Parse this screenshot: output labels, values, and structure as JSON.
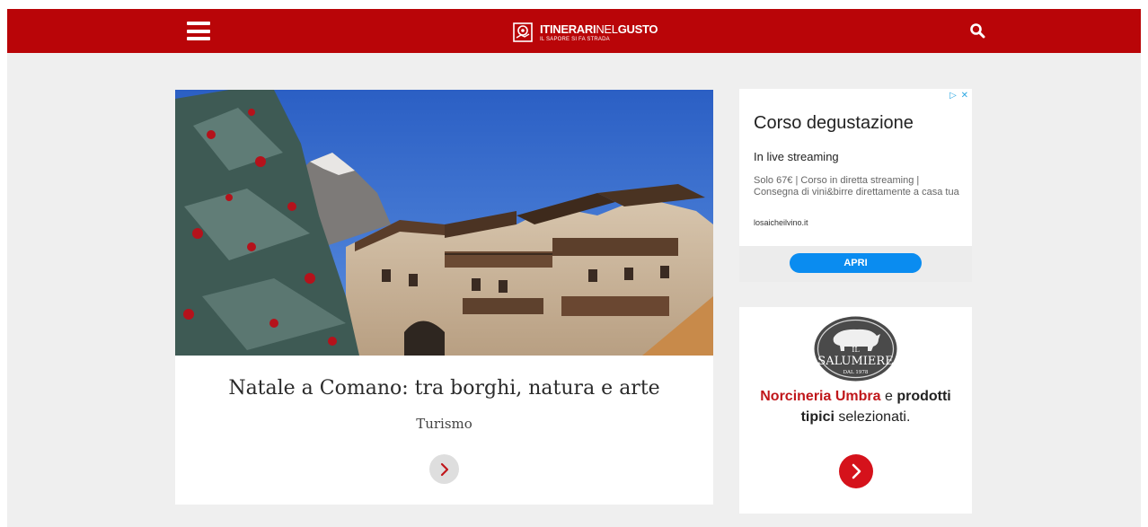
{
  "header": {
    "logo_title_bold_1": "ITINERARI",
    "logo_title_thin": "NEL",
    "logo_title_bold_2": "GUSTO",
    "logo_tagline": "IL SAPORE SI FA STRADA",
    "brand_color": "#b90508",
    "menu_icon": "hamburger-icon",
    "search_icon": "search-icon"
  },
  "article": {
    "title": "Natale a Comano: tra borghi, natura e arte",
    "category": "Turismo",
    "arrow_icon": "chevron-right-icon"
  },
  "ad": {
    "choices_label": "▷ ✕",
    "headline": "Corso degustazione",
    "subheadline": "In live streaming",
    "body": "Solo 67€ | Corso in diretta streaming | Consegna di vini&birre direttamente a casa tua",
    "domain": "losaicheilvino.it",
    "cta": "APRI",
    "cta_color": "#0a8cf0"
  },
  "promo": {
    "logo_line_1": "IL",
    "logo_line_2": "SALUMIERE",
    "logo_line_3": "DAL 1978",
    "text_red": "Norcineria Umbra",
    "text_mid": " e ",
    "text_bold": "prodotti tipici",
    "text_end": " selezionati.",
    "accent_color": "#d5121b",
    "arrow_icon": "chevron-right-icon"
  }
}
